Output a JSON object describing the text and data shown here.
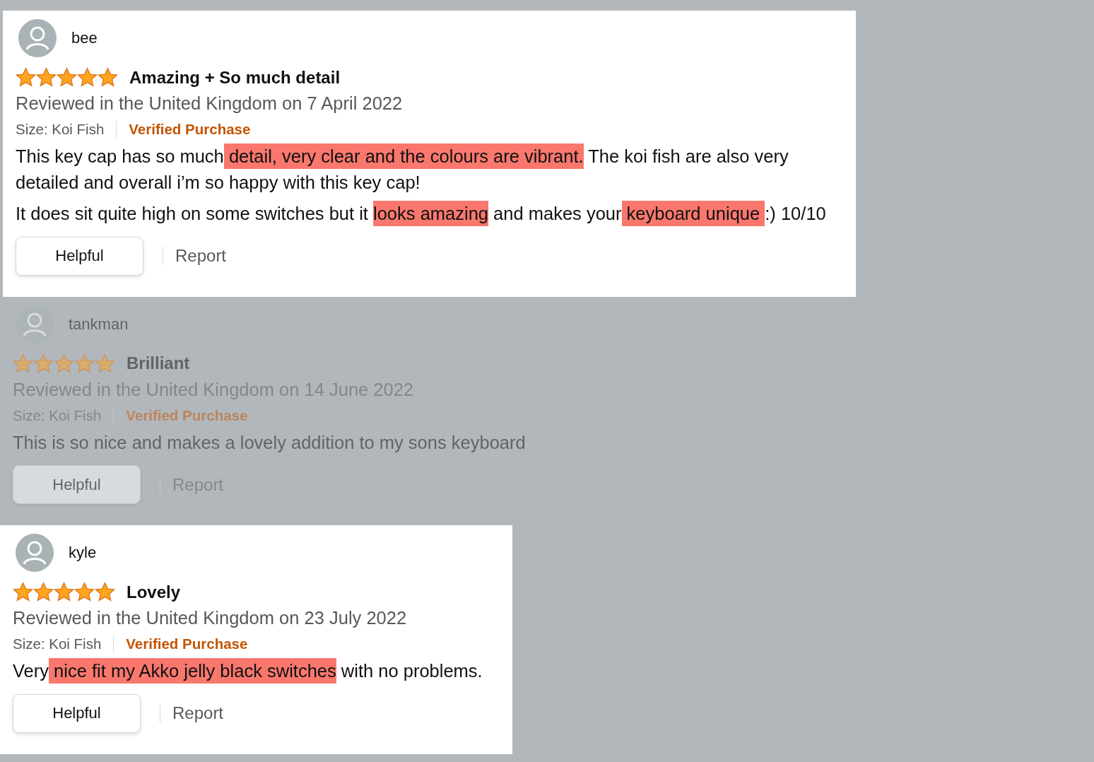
{
  "reviews": [
    {
      "reviewer": "bee",
      "dimmed": false,
      "stars": 5,
      "title": "Amazing + So much detail",
      "reviewed": "Reviewed in the United Kingdom on 7 April 2022",
      "size": "Size: Koi Fish",
      "badge": "Verified Purchase",
      "paragraphs": [
        [
          [
            {
              "text": "This key cap has so much",
              "highlighted": false
            },
            {
              "text": " detail, very clear and the colours are vibrant.",
              "highlighted": true
            },
            {
              "text": " The koi fish are also very",
              "highlighted": false
            }
          ],
          [
            {
              "text": "detailed and overall i’m so happy with this key cap!",
              "highlighted": false
            }
          ]
        ],
        [
          [
            {
              "text": "It does sit quite high on some switches but it ",
              "highlighted": false
            },
            {
              "text": "looks amazing",
              "highlighted": true
            },
            {
              "text": " and makes your",
              "highlighted": false
            },
            {
              "text": " keyboard unique ",
              "highlighted": true
            },
            {
              "text": ":) 10/10",
              "highlighted": false
            }
          ]
        ]
      ],
      "helpful": "Helpful",
      "report": "Report"
    },
    {
      "reviewer": "tankman",
      "dimmed": true,
      "stars": 5,
      "title": "Brilliant",
      "reviewed": "Reviewed in the United Kingdom on 14 June 2022",
      "size": "Size: Koi Fish",
      "badge": "Verified Purchase",
      "paragraphs": [
        [
          [
            {
              "text": "This is so nice and makes a lovely addition to my sons keyboard",
              "highlighted": false
            }
          ]
        ]
      ],
      "helpful": "Helpful",
      "report": "Report"
    },
    {
      "reviewer": "kyle",
      "dimmed": false,
      "stars": 5,
      "title": "Lovely",
      "reviewed": "Reviewed in the United Kingdom on 23 July 2022",
      "size": "Size: Koi Fish",
      "badge": "Verified Purchase",
      "paragraphs": [
        [
          [
            {
              "text": "Very",
              "highlighted": false
            },
            {
              "text": " nice fit my Akko jelly black switches",
              "highlighted": true
            },
            {
              "text": " with no problems.",
              "highlighted": false
            }
          ]
        ]
      ],
      "helpful": "Helpful",
      "report": "Report"
    }
  ]
}
